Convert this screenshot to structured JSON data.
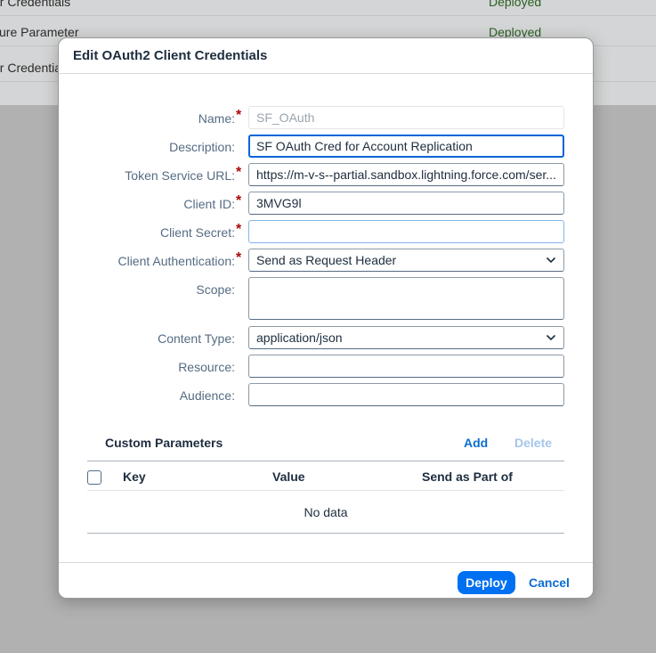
{
  "background": {
    "rows": [
      {
        "name": "er Credentials",
        "status": "Deployed"
      },
      {
        "name": "cure Parameter",
        "status": "Deployed"
      },
      {
        "name": "er Credentia",
        "status": ""
      }
    ]
  },
  "dialog": {
    "title": "Edit OAuth2 Client Credentials",
    "fields": {
      "name": {
        "label": "Name:",
        "value": "SF_OAuth",
        "required": true
      },
      "description": {
        "label": "Description:",
        "value": "SF OAuth Cred for Account Replication",
        "required": false
      },
      "token_url": {
        "label": "Token Service URL:",
        "value": "https://m-v-s--partial.sandbox.lightning.force.com/ser...",
        "required": true
      },
      "client_id": {
        "label": "Client ID:",
        "value": "3MVG9l",
        "required": true
      },
      "client_secret": {
        "label": "Client Secret:",
        "value": "",
        "required": true
      },
      "client_auth": {
        "label": "Client Authentication:",
        "value": "Send as Request Header",
        "required": true
      },
      "scope": {
        "label": "Scope:",
        "value": "",
        "required": false
      },
      "content_type": {
        "label": "Content Type:",
        "value": "application/json",
        "required": false
      },
      "resource": {
        "label": "Resource:",
        "value": "",
        "required": false
      },
      "audience": {
        "label": "Audience:",
        "value": "",
        "required": false
      }
    },
    "required_mark": "*",
    "custom_params": {
      "title": "Custom Parameters",
      "add_label": "Add",
      "delete_label": "Delete",
      "columns": [
        "Key",
        "Value",
        "Send as Part of"
      ],
      "empty_text": "No data"
    },
    "footer": {
      "deploy_label": "Deploy",
      "cancel_label": "Cancel"
    }
  },
  "colors": {
    "accent": "#0070f2",
    "link": "#0a6ed1",
    "required": "#aa0808",
    "deployed_status": "#2c5f24"
  },
  "icons": {
    "select_chevron": "chevron-down-icon"
  }
}
